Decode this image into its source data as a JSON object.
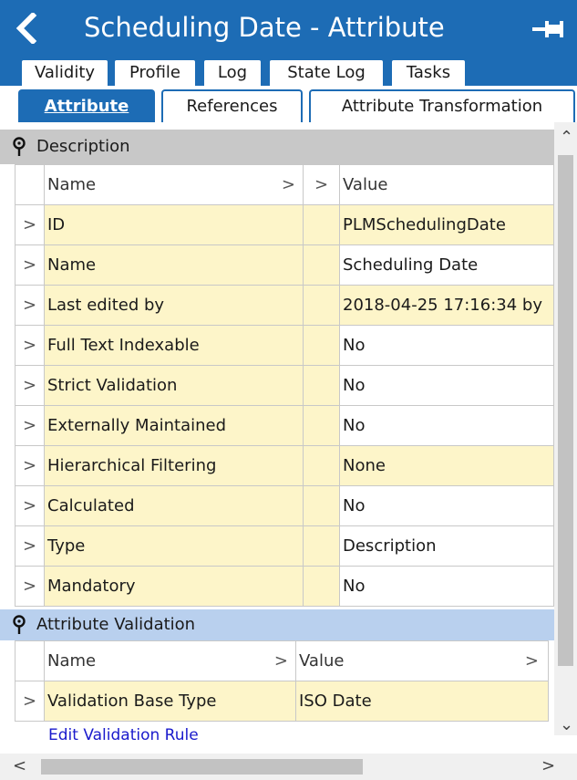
{
  "window": {
    "title": "Scheduling Date - Attribute",
    "back_icon": "chevron-left-icon",
    "pin_icon": "pin-icon",
    "accent": "#1d6cb5"
  },
  "tabs_row1": [
    {
      "label": "Validity"
    },
    {
      "label": "Profile"
    },
    {
      "label": "Log"
    },
    {
      "label": "State Log"
    },
    {
      "label": "Tasks"
    }
  ],
  "tabs_row2": [
    {
      "label": "Attribute",
      "active": true
    },
    {
      "label": "References"
    },
    {
      "label": "Attribute Transformation"
    }
  ],
  "description": {
    "header": "Description",
    "col_name": "Name",
    "col_value": "Value",
    "rows": [
      {
        "name": "ID",
        "value": "PLMSchedulingDate"
      },
      {
        "name": "Name",
        "value": "Scheduling Date"
      },
      {
        "name": "Last edited by",
        "value": "2018-04-25 17:16:34 by"
      },
      {
        "name": "Full Text Indexable",
        "value": "No"
      },
      {
        "name": "Strict Validation",
        "value": "No"
      },
      {
        "name": "Externally Maintained",
        "value": "No"
      },
      {
        "name": "Hierarchical Filtering",
        "value": "None"
      },
      {
        "name": "Calculated",
        "value": "No"
      },
      {
        "name": "Type",
        "value": "Description"
      },
      {
        "name": "Mandatory",
        "value": "No"
      }
    ]
  },
  "validation": {
    "header": "Attribute Validation",
    "col_name": "Name",
    "col_value": "Value",
    "rows": [
      {
        "name": "Validation Base Type",
        "value": "ISO Date"
      }
    ],
    "link": "Edit Validation Rule"
  }
}
